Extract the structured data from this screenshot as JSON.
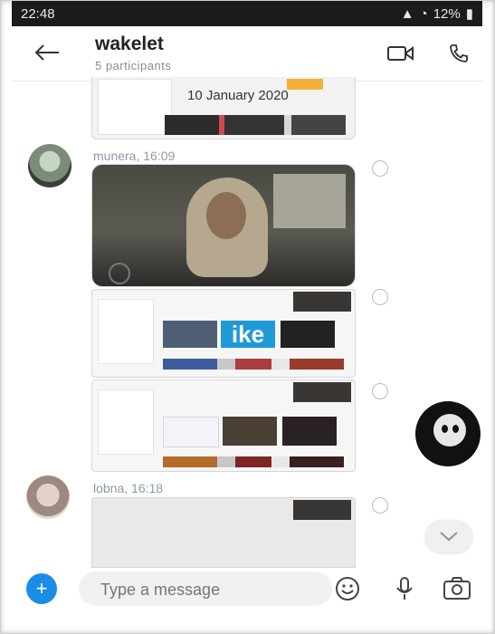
{
  "status_bar": {
    "time": "22:48",
    "battery": "12%"
  },
  "header": {
    "title": "wakelet",
    "subtitle": "5 participants",
    "back_icon": "arrow-left-icon",
    "video_icon": "video-camera-icon",
    "call_icon": "phone-icon"
  },
  "messages": [
    {
      "slide_text": "10 January 2020"
    },
    {
      "sender": "munera, 16:09",
      "ike_text": "ike"
    },
    {
      "sender": "lobna, 16:18"
    }
  ],
  "composer": {
    "plus_label": "+",
    "placeholder": "Type a message"
  },
  "colors": {
    "accent": "#1a8ee6",
    "sender_text": "#8f9aa6",
    "status_bar": "#1b1b1b"
  }
}
